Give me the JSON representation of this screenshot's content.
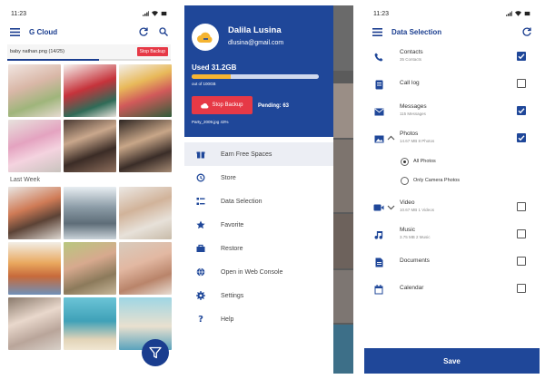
{
  "colors": {
    "primary": "#1f4799",
    "accent_red": "#e63946",
    "storage_fill": "#f5b431"
  },
  "status_bar": {
    "time": "11:23"
  },
  "gallery": {
    "title": "G Cloud",
    "backup_file": "baby nathan.png",
    "backup_count": "(14/25)",
    "stop_label": "Stop Backup",
    "backup_progress_fraction": 0.56,
    "section_label": "Last Week"
  },
  "drawer": {
    "user_name": "Dalila Lusina",
    "user_email": "dlusina@gmail.com",
    "used_label": "Used 31.2GB",
    "used_fraction": 0.31,
    "quota_label": "out of 100GB",
    "stop_label": "Stop Backup",
    "pending_label": "Pending: 63",
    "current_file": "Party_2009.jpg 43%",
    "items": [
      {
        "label": "Earn Free Spaces",
        "icon": "gift-icon"
      },
      {
        "label": "Store",
        "icon": "history-icon"
      },
      {
        "label": "Data Selection",
        "icon": "checklist-icon"
      },
      {
        "label": "Favorite",
        "icon": "star-icon"
      },
      {
        "label": "Restore",
        "icon": "restore-icon"
      },
      {
        "label": "Open in Web Console",
        "icon": "globe-icon"
      },
      {
        "label": "Settings",
        "icon": "gear-icon"
      },
      {
        "label": "Help",
        "icon": "question-icon"
      }
    ]
  },
  "data_selection": {
    "title": "Data Selection",
    "rows": [
      {
        "name": "Contacts",
        "sub": "35 Contacts",
        "checked": true
      },
      {
        "name": "Call log",
        "sub": "",
        "checked": false
      },
      {
        "name": "Messages",
        "sub": "115 Messages",
        "checked": true
      },
      {
        "name": "Photos",
        "sub": "14.67 MB    8 Photos",
        "checked": true
      },
      {
        "name": "Video",
        "sub": "10.67 MB    1 Videos",
        "checked": false
      },
      {
        "name": "Music",
        "sub": "3.75 MB    2 Music",
        "checked": false
      },
      {
        "name": "Documents",
        "sub": "",
        "checked": false
      },
      {
        "name": "Calendar",
        "sub": "",
        "checked": false
      }
    ],
    "photo_options": [
      {
        "label": "All Photos",
        "selected": true
      },
      {
        "label": "Only Camera Photos",
        "selected": false
      }
    ],
    "save_label": "Save"
  }
}
